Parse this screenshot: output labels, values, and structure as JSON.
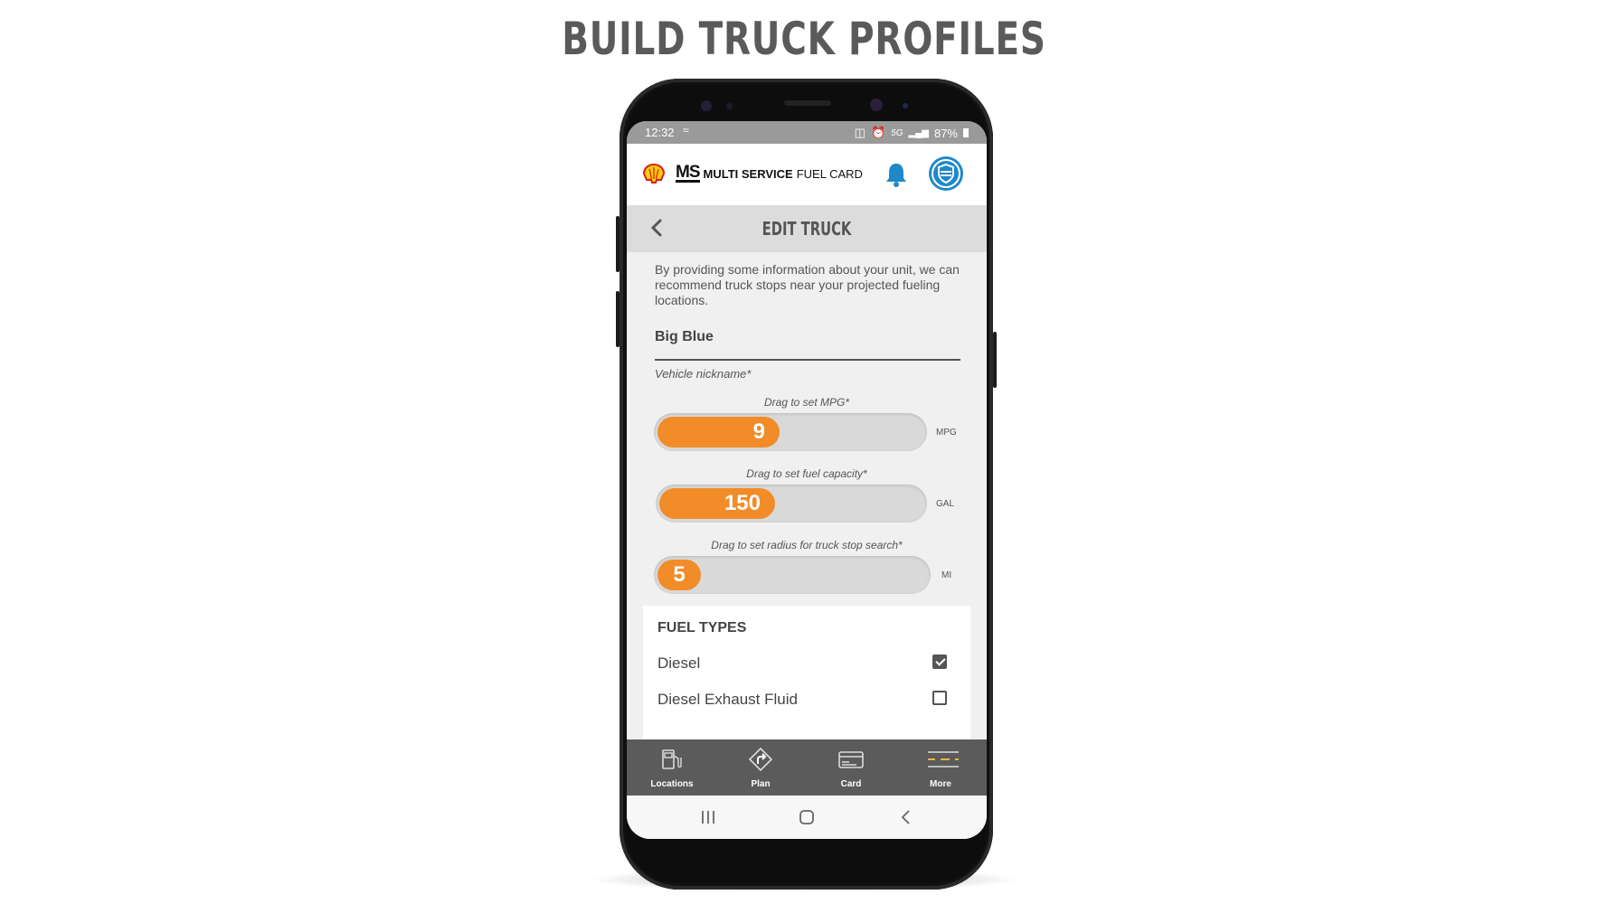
{
  "headline": "BUILD TRUCK PROFILES",
  "status_bar": {
    "time": "12:32",
    "network": "5G",
    "battery": "87%"
  },
  "app_bar": {
    "brand_mark": "MS",
    "brand_strong": "MULTI SERVICE",
    "brand_light": "FUEL CARD"
  },
  "screen_title": "EDIT TRUCK",
  "intro_text": "By providing some information about your unit, we can recommend truck stops near your projected fueling locations.",
  "nickname": {
    "value": "Big Blue",
    "label": "Vehicle nickname*"
  },
  "sliders": [
    {
      "label": "Drag to set MPG*",
      "value": "9",
      "unit": "MPG",
      "fill": 0.46
    },
    {
      "label": "Drag to set fuel capacity*",
      "value": "150",
      "unit": "GAL",
      "fill": 0.44
    },
    {
      "label": "Drag to set radius for truck stop search*",
      "value": "5",
      "unit": "MI",
      "fill": 0.16
    }
  ],
  "fuel_types": {
    "title": "FUEL TYPES",
    "items": [
      {
        "label": "Diesel",
        "checked": true
      },
      {
        "label": "Diesel Exhaust Fluid",
        "checked": false
      }
    ]
  },
  "tabs": [
    {
      "label": "Locations",
      "icon": "fuel-pump-icon"
    },
    {
      "label": "Plan",
      "icon": "route-sign-icon"
    },
    {
      "label": "Card",
      "icon": "card-icon"
    },
    {
      "label": "More",
      "icon": "menu-icon"
    }
  ],
  "colors": {
    "accent": "#f28c28",
    "brand_blue": "#1f88c9",
    "tabbar": "#5b5b5b"
  }
}
